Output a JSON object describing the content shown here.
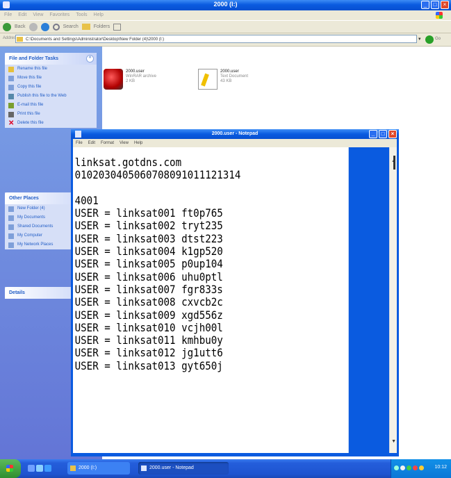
{
  "explorer": {
    "title": "2000 (I:)",
    "menu": [
      "File",
      "Edit",
      "View",
      "Favorites",
      "Tools",
      "Help"
    ],
    "toolbar": {
      "back_label": "Back",
      "search_label": "Search",
      "folders_label": "Folders"
    },
    "address": {
      "label": "Address",
      "value": "C:\\Documents and Settings\\Administrator\\Desktop\\New Folder (4)\\2000 (I:)",
      "go_label": "Go"
    },
    "tasks": {
      "header": "File and Folder Tasks",
      "items": [
        "Rename this file",
        "Move this file",
        "Copy this file",
        "Publish this file to the Web",
        "E-mail this file",
        "Print this file",
        "Delete this file"
      ]
    },
    "other_places": {
      "header": "Other Places",
      "items": [
        "New Folder (4)",
        "My Documents",
        "Shared Documents",
        "My Computer",
        "My Network Places"
      ]
    },
    "details": {
      "header": "Details"
    },
    "files": [
      {
        "name": "2000.user",
        "type": "WinRAR archive",
        "size": "2 KB",
        "icon": "winrar-archive-icon"
      },
      {
        "name": "2000.user",
        "type": "Text Document",
        "size": "43 KB",
        "icon": "text-document-icon"
      }
    ]
  },
  "notepad": {
    "title": "2000.user - Notepad",
    "menu": [
      "File",
      "Edit",
      "Format",
      "View",
      "Help"
    ],
    "lines": [
      "linksat.gotdns.com",
      "0102030405060708091011121314",
      "",
      "4001",
      "USER = linksat001 ft0p765",
      "USER = linksat002 tryt235",
      "USER = linksat003 dtst223",
      "USER = linksat004 k1gp520",
      "USER = linksat005 p0up104",
      "USER = linksat006 uhu0ptl",
      "USER = linksat007 fgr833s",
      "USER = linksat008 cxvcb2c",
      "USER = linksat009 xgd556z",
      "USER = linksat010 vcjh00l",
      "USER = linksat011 kmhbu0y",
      "USER = linksat012 jg1utt6",
      "USER = linksat013 gyt650j"
    ]
  },
  "taskbar": {
    "buttons": [
      "2000 (I:)",
      "2000.user - Notepad"
    ],
    "clock": "10:12"
  },
  "colors": {
    "titlebar_blue": "#0a5be0",
    "taskpane_blue": "#6375d6",
    "close_red": "#e0482a"
  }
}
